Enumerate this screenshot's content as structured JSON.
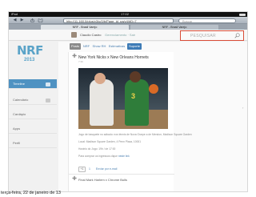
{
  "statusbar": {
    "carrier": "iPad",
    "time": "17:02"
  },
  "browser": {
    "back": "◀",
    "forward": "▶",
    "url": "http://11.160.0/plus/v3/u/0/b/Page_id_pa/v4/#D=7",
    "search_placeholder": "Buscar",
    "tabs": [
      {
        "label": "NRF - Brasil Varejo"
      },
      {
        "label": "NRF - Brasil Varejo"
      }
    ]
  },
  "app_header": {
    "user_name": "Claudio Castro",
    "links": "Gerenciamento · Sair",
    "search_placeholder": "PESQUISAR"
  },
  "sidebar": {
    "logo_text": "NRF",
    "logo_year": "2013",
    "items": [
      {
        "label": "Timeline",
        "active": true
      },
      {
        "label": "Calendário",
        "active": false
      },
      {
        "label": "Cardápio",
        "active": false
      },
      {
        "label": "Apps",
        "active": false
      },
      {
        "label": "Perfil",
        "active": false
      }
    ]
  },
  "content_tabs": [
    {
      "label": "Posts",
      "style": "active"
    },
    {
      "label": "NRF",
      "style": "plain"
    },
    {
      "label": "Show RH",
      "style": "plain"
    },
    {
      "label": "Estimativas",
      "style": "plain"
    },
    {
      "label": "Suporte",
      "style": "blue"
    }
  ],
  "post": {
    "title": "New York Nicks x New Orleans Hornets",
    "date": "7:39",
    "lines": [
      "Jogo de basquete no sábado: nos ténnis de Nova Grarpe a de Mendon, Madison Square Garden",
      "Local: Madison Square Garden, 4 Penn Plaza, 10001",
      "Horário do Jogo: 19h / de 17:00",
      "Para comprar os ingressos clique"
    ],
    "link_text": "neste link",
    "plus_one": "+1",
    "action_count": "1",
    "action_label": "Enviar por e-mail"
  },
  "post2": {
    "title": "Final Mark Harlem x Chrome Bulls"
  },
  "caption": "terça-feira, 22 de janeiro de 13"
}
